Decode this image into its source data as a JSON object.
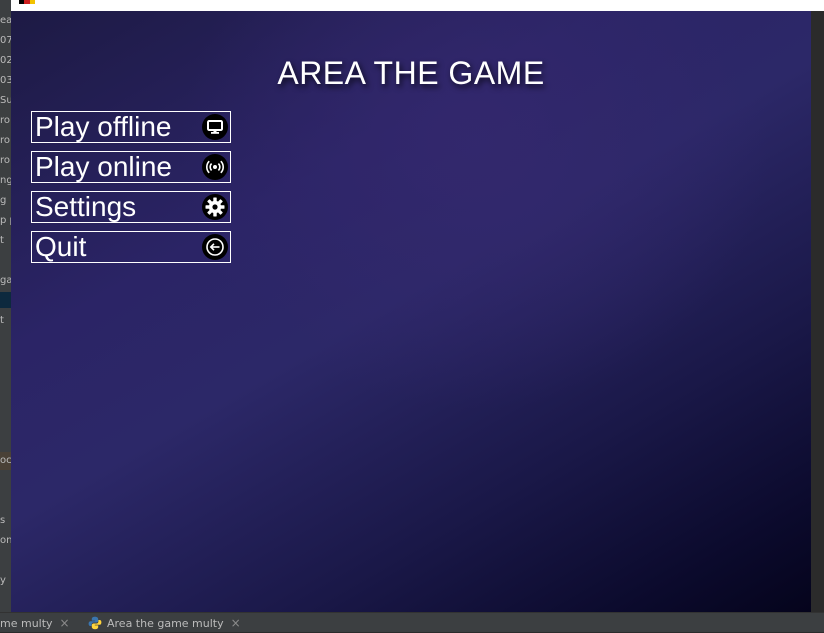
{
  "game": {
    "title": "AREA THE GAME",
    "menu": [
      {
        "label": "Play offline",
        "icon": "monitor-icon"
      },
      {
        "label": "Play online",
        "icon": "broadcast-icon"
      },
      {
        "label": "Settings",
        "icon": "gear-icon"
      },
      {
        "label": "Quit",
        "icon": "exit-icon"
      }
    ]
  },
  "ide": {
    "left_fragments": [
      "ea",
      "07",
      "02",
      "03",
      "Su",
      "ro",
      "ro",
      "ro",
      "ng",
      "g",
      "p p",
      "t",
      "gai",
      "t",
      "oc",
      "s",
      "on",
      "y"
    ],
    "tabs": [
      {
        "label": "me multy",
        "close": "×"
      },
      {
        "label": "Area the game multy",
        "close": "×",
        "icon": "python-icon"
      }
    ]
  },
  "colors": {
    "background_top": "#2b2466",
    "background_bottom": "#05041c",
    "text": "#ffffff",
    "icon_bg": "#000000"
  }
}
